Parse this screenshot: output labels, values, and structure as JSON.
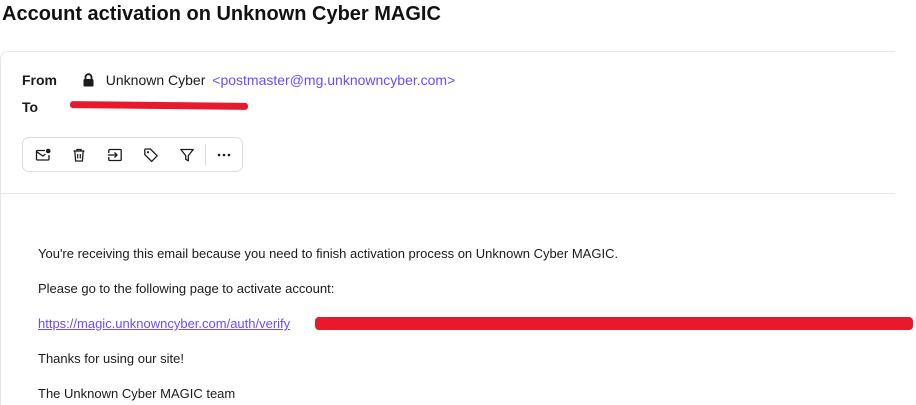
{
  "subject": "Account activation on Unknown Cyber MAGIC",
  "header": {
    "from_label": "From",
    "to_label": "To",
    "sender_name": "Unknown Cyber",
    "sender_email": "<postmaster@mg.unknowncyber.com>"
  },
  "toolbar": {
    "buttons": [
      {
        "icon": "mark-unread-icon"
      },
      {
        "icon": "trash-icon"
      },
      {
        "icon": "move-icon"
      },
      {
        "icon": "tag-icon"
      },
      {
        "icon": "filter-icon"
      },
      {
        "icon": "more-icon"
      }
    ]
  },
  "body": {
    "p1": "You're receiving this email because you need to finish activation process on Unknown Cyber MAGIC.",
    "p2": "Please go to the following page to activate account:",
    "link": "https://magic.unknowncyber.com/auth/verify",
    "p4": "Thanks for using our site!",
    "p5": "The Unknown Cyber MAGIC team"
  },
  "colors": {
    "link": "#6d4aff",
    "redaction": "#e8192c"
  }
}
